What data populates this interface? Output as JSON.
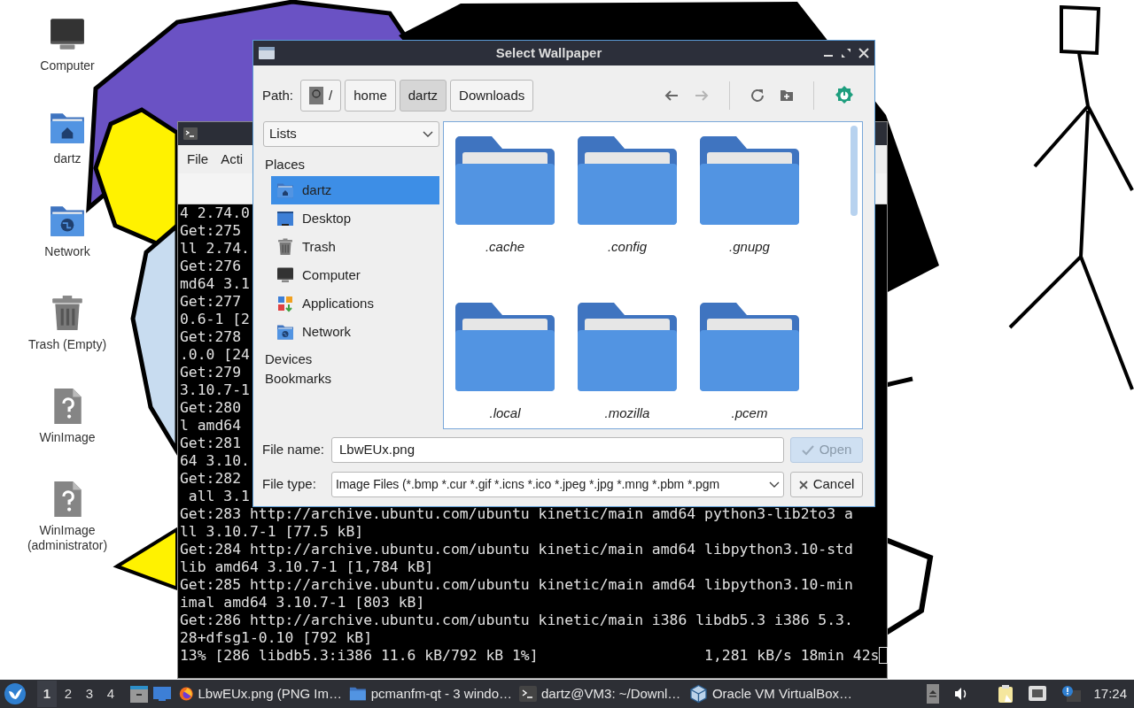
{
  "desktop_icons": [
    {
      "label": "Computer",
      "kind": "computer"
    },
    {
      "label": "dartz",
      "kind": "home"
    },
    {
      "label": "Network",
      "kind": "network"
    },
    {
      "label": "Trash (Empty)",
      "kind": "trash"
    },
    {
      "label": "WinImage",
      "kind": "unknown"
    },
    {
      "label": "WinImage (administrator)",
      "kind": "unknown"
    }
  ],
  "terminal": {
    "menu": [
      "File",
      "Acti"
    ],
    "lines": [
      "4 2.74.0",
      "Get:275",
      "ll 2.74.",
      "Get:276",
      "md64 3.1",
      "Get:277",
      "0.6-1 [2",
      "Get:278",
      ".0.0 [24",
      "Get:279",
      "3.10.7-1",
      "Get:280",
      "l amd64",
      "Get:281",
      "64 3.10.",
      "Get:282",
      " all 3.1",
      "Get:283 http://archive.ubuntu.com/ubuntu kinetic/main amd64 python3-lib2to3 a",
      "ll 3.10.7-1 [77.5 kB]",
      "Get:284 http://archive.ubuntu.com/ubuntu kinetic/main amd64 libpython3.10-std",
      "lib amd64 3.10.7-1 [1,784 kB]",
      "Get:285 http://archive.ubuntu.com/ubuntu kinetic/main amd64 libpython3.10-min",
      "imal amd64 3.10.7-1 [803 kB]",
      "Get:286 http://archive.ubuntu.com/ubuntu kinetic/main i386 libdb5.3 i386 5.3.",
      "28+dfsg1-0.10 [792 kB]",
      "13% [286 libdb5.3:i386 11.6 kB/792 kB 1%]                   1,281 kB/s 18min 42s"
    ]
  },
  "dialog": {
    "title": "Select Wallpaper",
    "path_label": "Path:",
    "path": [
      {
        "label": "/",
        "kind": "root",
        "selected": false
      },
      {
        "label": "home",
        "kind": "dir",
        "selected": false
      },
      {
        "label": "dartz",
        "kind": "dir",
        "selected": true
      },
      {
        "label": "Downloads",
        "kind": "dir",
        "selected": false
      }
    ],
    "toolbar": [
      {
        "kind": "back",
        "disabled": false
      },
      {
        "kind": "forward",
        "disabled": true
      },
      {
        "kind": "reload",
        "disabled": false
      },
      {
        "kind": "new_folder",
        "disabled": false
      },
      {
        "kind": "app",
        "disabled": false
      }
    ],
    "view_mode": "Lists",
    "sections": [
      {
        "title": "Places",
        "items": [
          {
            "label": "dartz",
            "kind": "home",
            "selected": true
          },
          {
            "label": "Desktop",
            "kind": "desktop",
            "selected": false
          },
          {
            "label": "Trash",
            "kind": "trash",
            "selected": false
          },
          {
            "label": "Computer",
            "kind": "computer",
            "selected": false
          },
          {
            "label": "Applications",
            "kind": "applications",
            "selected": false
          },
          {
            "label": "Network",
            "kind": "network",
            "selected": false
          }
        ]
      },
      {
        "title": "Devices"
      },
      {
        "title": "Bookmarks"
      }
    ],
    "files": [
      {
        "name": ".cache"
      },
      {
        "name": ".config"
      },
      {
        "name": ".gnupg"
      },
      {
        "name": ".local"
      },
      {
        "name": ".mozilla"
      },
      {
        "name": ".pcem"
      }
    ],
    "file_name_label": "File name:",
    "file_name": "LbwEUx.png",
    "file_type_label": "File type:",
    "file_type": "Image Files (*.bmp *.cur *.gif *.icns *.ico *.jpeg *.jpg *.mng *.pbm *.pgm",
    "buttons": [
      {
        "label": "Open",
        "kind": "open",
        "disabled": true
      },
      {
        "label": "Cancel",
        "kind": "cancel",
        "disabled": false
      }
    ]
  },
  "taskbar": {
    "desktops": [
      {
        "label": "1",
        "selected": true
      },
      {
        "label": "2",
        "selected": false
      },
      {
        "label": "3",
        "selected": false
      },
      {
        "label": "4",
        "selected": false
      }
    ],
    "tasks": [
      {
        "label": "LbwEUx.png (PNG Im…",
        "kind": "browser"
      },
      {
        "label": "pcmanfm-qt - 3 windo…",
        "kind": "files"
      },
      {
        "label": "dartz@VM3: ~/Downl…",
        "kind": "terminal"
      },
      {
        "label": "Oracle VM VirtualBox…",
        "kind": "virtualbox"
      }
    ],
    "clock": "17:24"
  }
}
